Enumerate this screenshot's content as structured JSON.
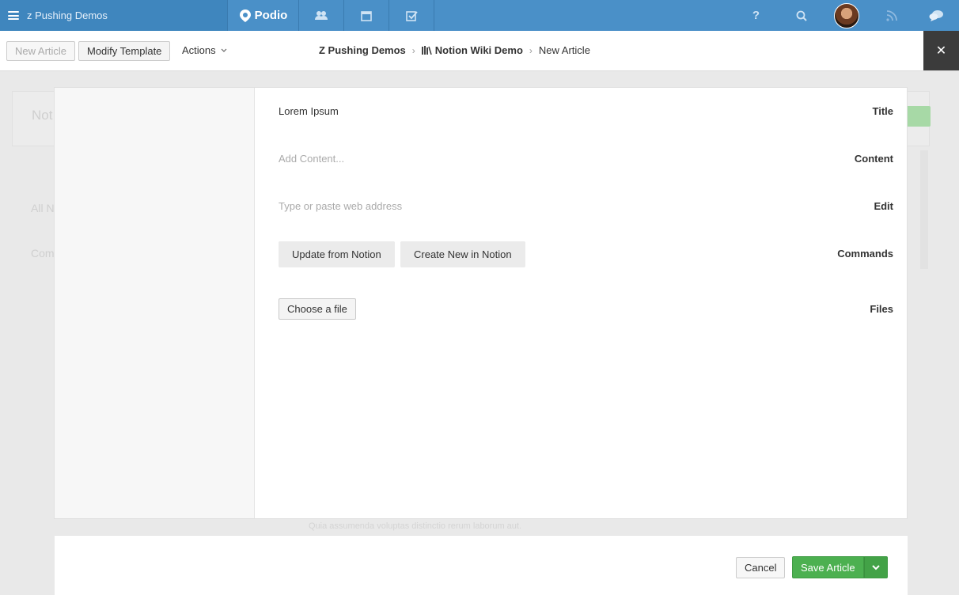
{
  "topnav": {
    "workspace_name": "z Pushing Demos",
    "brand": "Podio",
    "icons": [
      "menu-icon",
      "podio-logo-icon",
      "contacts-icon",
      "calendar-icon",
      "tasks-icon",
      "help-icon",
      "search-icon",
      "avatar",
      "activity-stream-icon",
      "chat-icon"
    ]
  },
  "subheader": {
    "new_article_label": "New Article",
    "modify_template_label": "Modify Template",
    "actions_label": "Actions",
    "breadcrumb": {
      "workspace": "Z Pushing Demos",
      "app": "Notion Wiki Demo",
      "current": "New Article"
    }
  },
  "background": {
    "faded_title": "Not",
    "faded_filter": "All N",
    "faded_comment": "Com",
    "faded_snippet_line1": "Quia assumenda voluptas distinctio rerum laborum aut."
  },
  "form": {
    "title_label": "Title",
    "title_value": "Lorem Ipsum",
    "content_label": "Content",
    "content_placeholder": "Add Content...",
    "edit_label": "Edit",
    "edit_placeholder": "Type or paste web address",
    "commands_label": "Commands",
    "update_button": "Update from Notion",
    "create_button": "Create New in Notion",
    "files_label": "Files",
    "choose_file_button": "Choose a file"
  },
  "footer": {
    "cancel_label": "Cancel",
    "save_label": "Save Article"
  },
  "colors": {
    "nav_blue": "#4a90c8",
    "save_green": "#4cb050"
  }
}
